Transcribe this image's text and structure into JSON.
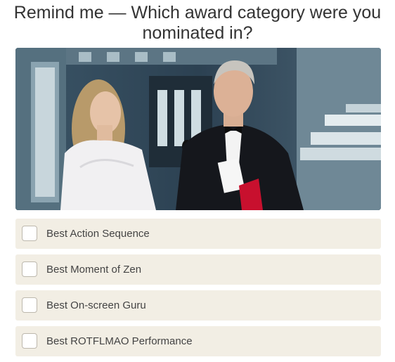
{
  "question": {
    "text": "Remind me — Which award category were you nominated in?"
  },
  "options": [
    {
      "label": "Best Action Sequence",
      "checked": false
    },
    {
      "label": "Best Moment of Zen",
      "checked": false
    },
    {
      "label": "Best On-screen Guru",
      "checked": false
    },
    {
      "label": "Best ROTFLMAO Performance",
      "checked": false
    }
  ],
  "colors": {
    "option_background": "#f2eee4",
    "checkbox_border": "#bdb8ad",
    "text": "#333333"
  }
}
